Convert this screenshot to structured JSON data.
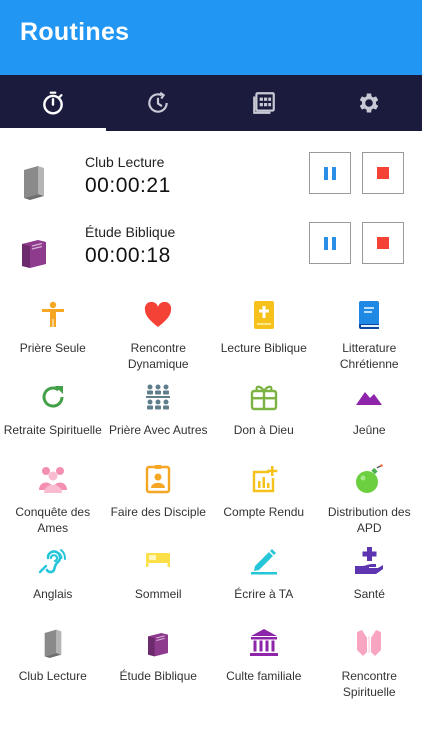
{
  "appbar": {
    "title": "Routines"
  },
  "colors": {
    "primary": "#2196f3",
    "tabbar": "#1b1c3d",
    "pause": "#2a8ee6",
    "stop": "#f44336"
  },
  "tabs": [
    {
      "icon": "stopwatch-icon",
      "selected": true
    },
    {
      "icon": "history-icon",
      "selected": false
    },
    {
      "icon": "calendar-grid-icon",
      "selected": false
    },
    {
      "icon": "gear-icon",
      "selected": false
    }
  ],
  "active_timers": [
    {
      "name": "Club Lecture",
      "time": "00:00:21",
      "icon": "book-gray-icon"
    },
    {
      "name": "Étude Biblique",
      "time": "00:00:18",
      "icon": "book-purple-icon"
    }
  ],
  "routines": [
    {
      "label": "Prière Seule",
      "icon": "person-icon",
      "color": "#f5a623"
    },
    {
      "label": "Rencontre Dynamique",
      "icon": "heart-icon",
      "color": "#f44336"
    },
    {
      "label": "Lecture Biblique",
      "icon": "bible-icon",
      "color": "#f6c11b"
    },
    {
      "label": "Litterature Chrétienne",
      "icon": "book-blue-icon",
      "color": "#1e88e5"
    },
    {
      "label": "Retraite Spirituelle",
      "icon": "refresh-icon",
      "color": "#43a047"
    },
    {
      "label": "Prière Avec Autres",
      "icon": "group-icon",
      "color": "#607d8b"
    },
    {
      "label": "Don à Dieu",
      "icon": "gift-icon",
      "color": "#7cb342"
    },
    {
      "label": "Jeûne",
      "icon": "mountain-icon",
      "color": "#8e24aa"
    },
    {
      "label": "Conquête des Ames",
      "icon": "people-icon",
      "color": "#f48fb1"
    },
    {
      "label": "Faire des Disciple",
      "icon": "badge-icon",
      "color": "#f5a623"
    },
    {
      "label": "Compte Rendu",
      "icon": "chart-add-icon",
      "color": "#f6c11b"
    },
    {
      "label": "Distribution des APD",
      "icon": "bomb-icon",
      "color": "#6ccf3f"
    },
    {
      "label": "Anglais",
      "icon": "hearing-icon",
      "color": "#26c6da"
    },
    {
      "label": "Sommeil",
      "icon": "bed-icon",
      "color": "#fde047"
    },
    {
      "label": "Écrire à TA",
      "icon": "pen-icon",
      "color": "#26c6da"
    },
    {
      "label": "Santé",
      "icon": "health-hand-icon",
      "color": "#5e35b1"
    },
    {
      "label": "Club Lecture",
      "icon": "book-gray-icon",
      "color": "#8a8a8a"
    },
    {
      "label": "Étude Biblique",
      "icon": "book-purple-icon",
      "color": "#8e3b8e"
    },
    {
      "label": "Culte familiale",
      "icon": "temple-icon",
      "color": "#8e24aa"
    },
    {
      "label": "Rencontre Spirituelle",
      "icon": "pray-icon",
      "color": "#f8a5c2"
    }
  ]
}
